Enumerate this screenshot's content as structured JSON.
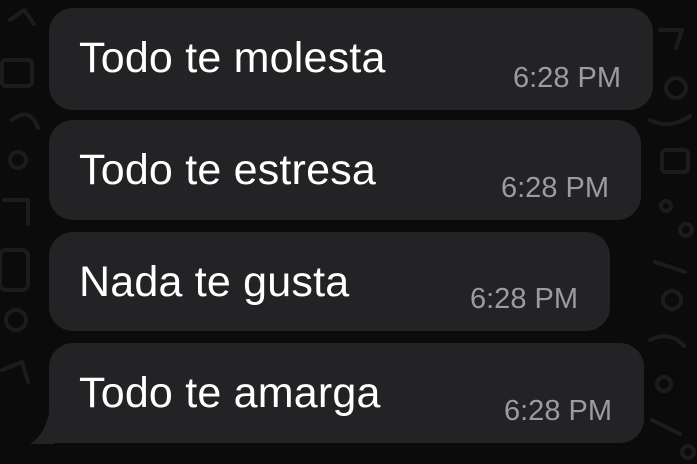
{
  "chat": {
    "messages": [
      {
        "text": "Todo te molesta",
        "time": "6:28 PM"
      },
      {
        "text": "Todo te estresa",
        "time": "6:28 PM"
      },
      {
        "text": "Nada te gusta",
        "time": "6:28 PM"
      },
      {
        "text": "Todo te amarga",
        "time": "6:28 PM"
      }
    ]
  },
  "colors": {
    "background": "#0b0b0b",
    "bubble": "#232326",
    "message_text": "#ffffff",
    "timestamp": "#9b9ba0"
  }
}
